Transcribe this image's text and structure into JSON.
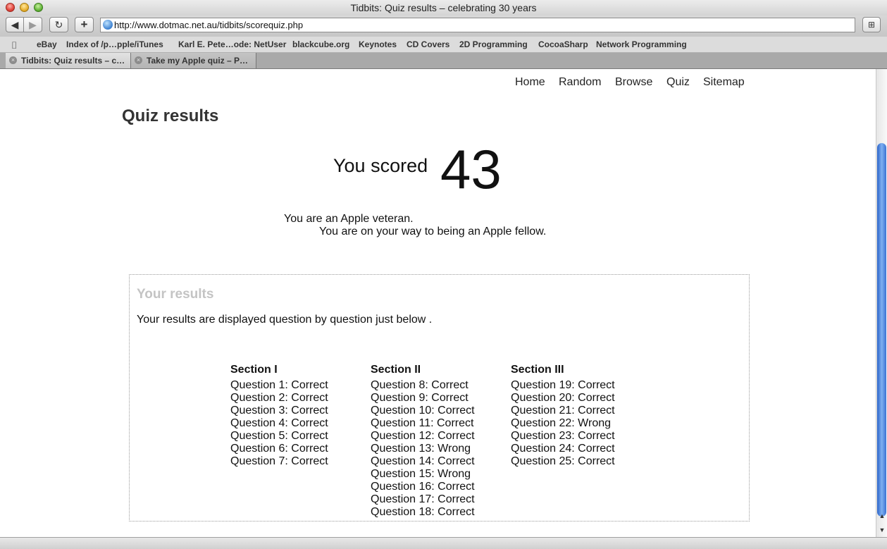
{
  "window": {
    "title": "Tidbits: Quiz results – celebrating 30 years"
  },
  "toolbar": {
    "back": "◀",
    "forward": "▶",
    "reload": "↻",
    "add": "+",
    "tabs_button": "⊞",
    "url": "http://www.dotmac.net.au/tidbits/scorequiz.php"
  },
  "bookmarks": {
    "book_icon": "⌷",
    "items": [
      "eBay",
      "Index of /p…pple/iTunes",
      "Karl E. Pete…ode: NetUser",
      "blackcube.org",
      "Keynotes",
      "CD Covers",
      "2D Programming",
      "CocoaSharp",
      "Network Programming"
    ]
  },
  "tabs": [
    {
      "label": "Tidbits: Quiz results – c…",
      "close": "×"
    },
    {
      "label": "Take my Apple quiz – P…",
      "close": "×"
    }
  ],
  "nav": [
    "Home",
    "Random",
    "Browse",
    "Quiz",
    "Sitemap"
  ],
  "page": {
    "title": "Quiz results",
    "score_label": "You scored",
    "score": "43",
    "message_1": "You are an Apple veteran.",
    "message_2": "You are on your way to being an Apple fellow."
  },
  "results": {
    "heading": "Your results",
    "intro": "Your results are displayed question by question just below .",
    "sections": [
      {
        "title": "Section I",
        "questions": [
          "Question 1: Correct",
          "Question 2: Correct",
          "Question 3: Correct",
          "Question 4: Correct",
          "Question 5: Correct",
          "Question 6: Correct",
          "Question 7: Correct"
        ]
      },
      {
        "title": "Section II",
        "questions": [
          "Question 8: Correct",
          "Question 9: Correct",
          "Question 10: Correct",
          "Question 11: Correct",
          "Question 12: Correct",
          "Question 13: Wrong",
          "Question 14: Correct",
          "Question 15: Wrong",
          "Question 16: Correct",
          "Question 17: Correct",
          "Question 18: Correct"
        ]
      },
      {
        "title": "Section III",
        "questions": [
          "Question 19: Correct",
          "Question 20: Correct",
          "Question 21: Correct",
          "Question 22: Wrong",
          "Question 23: Correct",
          "Question 24: Correct",
          "Question 25: Correct"
        ]
      }
    ]
  },
  "scrollbar": {
    "up": "▲",
    "down": "▼"
  }
}
